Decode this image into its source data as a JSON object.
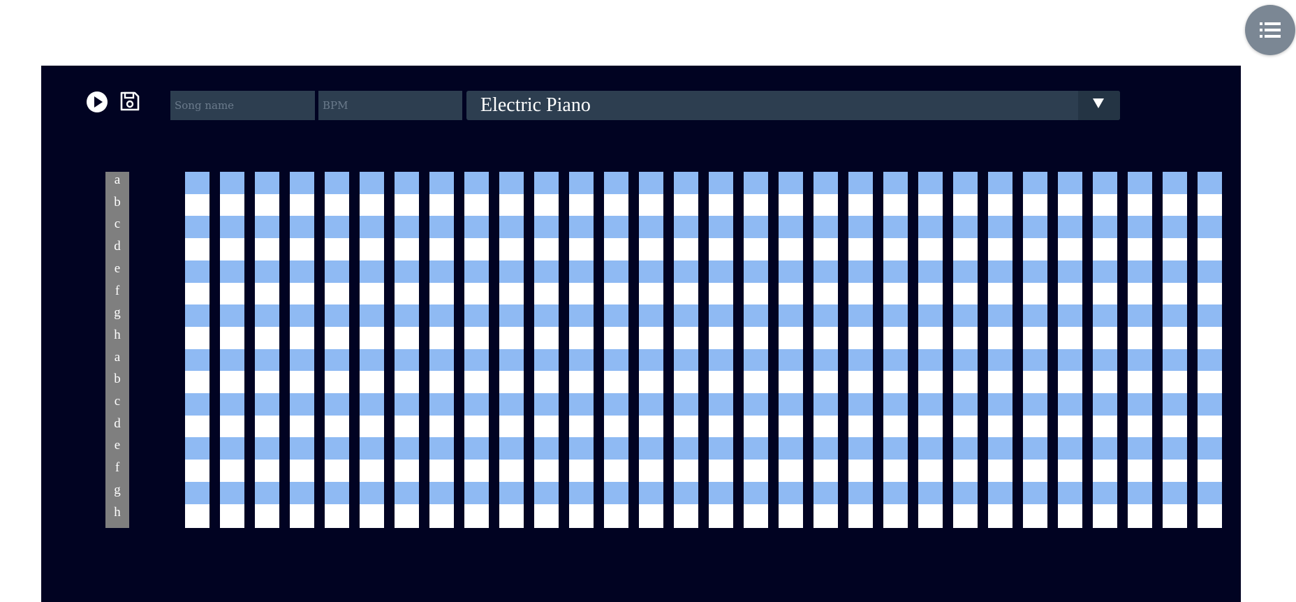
{
  "menu": {
    "icon": "list-icon"
  },
  "toolbar": {
    "play_icon": "play-icon",
    "save_icon": "save-icon",
    "song_name_placeholder": "Song name",
    "song_name_value": "",
    "bpm_placeholder": "BPM",
    "bpm_value": "",
    "instrument": "Electric Piano",
    "instrument_arrow_icon": "chevron-down-icon"
  },
  "notes": [
    "a",
    "b",
    "c",
    "d",
    "e",
    "f",
    "g",
    "h",
    "a",
    "b",
    "c",
    "d",
    "e",
    "f",
    "g",
    "h"
  ],
  "grid": {
    "rows": 16,
    "visible_columns": 31,
    "row_colors": [
      "#8fbaf3",
      "#ffffff"
    ],
    "active_cells": []
  },
  "colors": {
    "panel_background": "#010322",
    "input_background": "#2d3e50",
    "label_background": "#7f7f7f",
    "row_blue": "#8fbaf3",
    "row_white": "#ffffff",
    "fab": "#7b8794"
  }
}
